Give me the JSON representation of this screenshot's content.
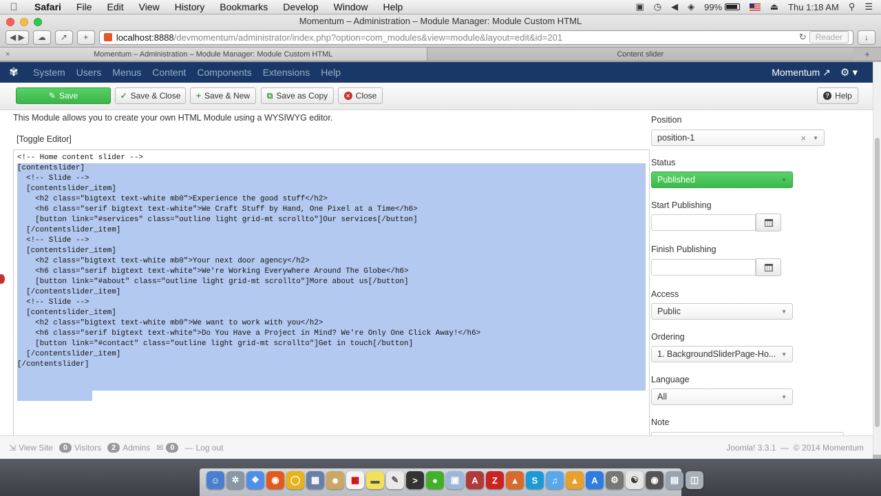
{
  "menubar": {
    "app": "Safari",
    "items": [
      "File",
      "Edit",
      "View",
      "History",
      "Bookmarks",
      "Develop",
      "Window",
      "Help"
    ],
    "battery": "99%",
    "clock": "Thu 1:18 AM"
  },
  "browser": {
    "window_title": "Momentum – Administration – Module Manager: Module Custom HTML",
    "url_host": "localhost:8888",
    "url_path": "/devmomentum/administrator/index.php?option=com_modules&view=module&layout=edit&id=201",
    "reader_label": "Reader",
    "tabs": [
      {
        "title": "Momentum – Administration – Module Manager: Module Custom HTML",
        "active": true
      },
      {
        "title": "Content slider",
        "active": false
      }
    ]
  },
  "jnav": {
    "items": [
      "System",
      "Users",
      "Menus",
      "Content",
      "Components",
      "Extensions",
      "Help"
    ],
    "site_name": "Momentum"
  },
  "actions": {
    "save": "Save",
    "save_close": "Save & Close",
    "save_new": "Save & New",
    "save_copy": "Save as Copy",
    "close": "Close",
    "help": "Help"
  },
  "main": {
    "description": "This Module allows you to create your own HTML Module using a WYSIWYG editor.",
    "toggle_editor": "[Toggle Editor]",
    "code_lines": [
      "<!-- Home content slider -->",
      "[contentslider]",
      "  <!-- Slide -->",
      "  [contentslider_item]",
      "    <h2 class=\"bigtext text-white mb0\">Experience the good stuff</h2>",
      "    <h6 class=\"serif bigtext text-white\">We Craft Stuff by Hand, One Pixel at a Time</h6>",
      "    [button link=\"#services\" class=\"outline light grid-mt scrollto\"]Our services[/button]",
      "  [/contentslider_item]",
      "",
      "  <!-- Slide -->",
      "  [contentslider_item]",
      "    <h2 class=\"bigtext text-white mb0\">Your next door agency</h2>",
      "    <h6 class=\"serif bigtext text-white\">We're Working Everywhere Around The Globe</h6>",
      "    [button link=\"#about\" class=\"outline light grid-mt scrollto\"]More about us[/button]",
      "  [/contentslider_item]",
      "",
      "  <!-- Slide -->",
      "  [contentslider_item]",
      "    <h2 class=\"bigtext text-white mb0\">We want to work with you</h2>",
      "    <h6 class=\"serif bigtext text-white\">Do You Have a Project in Mind? We're Only One Click Away!</h6>",
      "    [button link=\"#contact\" class=\"outline light grid-mt scrollto\"]Get in touch[/button]",
      "  [/contentslider_item]",
      "",
      "[/contentslider]"
    ]
  },
  "sidebar": {
    "position_label": "Position",
    "position_value": "position-1",
    "status_label": "Status",
    "status_value": "Published",
    "start_label": "Start Publishing",
    "finish_label": "Finish Publishing",
    "access_label": "Access",
    "access_value": "Public",
    "ordering_label": "Ordering",
    "ordering_value": "1. BackgroundSliderPage-Ho...",
    "language_label": "Language",
    "language_value": "All",
    "note_label": "Note"
  },
  "statusbar": {
    "view_site": "View Site",
    "visitors_count": "0",
    "visitors_label": "Visitors",
    "admins_count": "2",
    "admins_label": "Admins",
    "messages_count": "0",
    "logout": "Log out",
    "version": "Joomla! 3.3.1",
    "copyright": "© 2014 Momentum"
  },
  "colors": {
    "nav_bg": "#1a3867",
    "save_green": "#46c456",
    "selection": "#b4c9f0"
  }
}
